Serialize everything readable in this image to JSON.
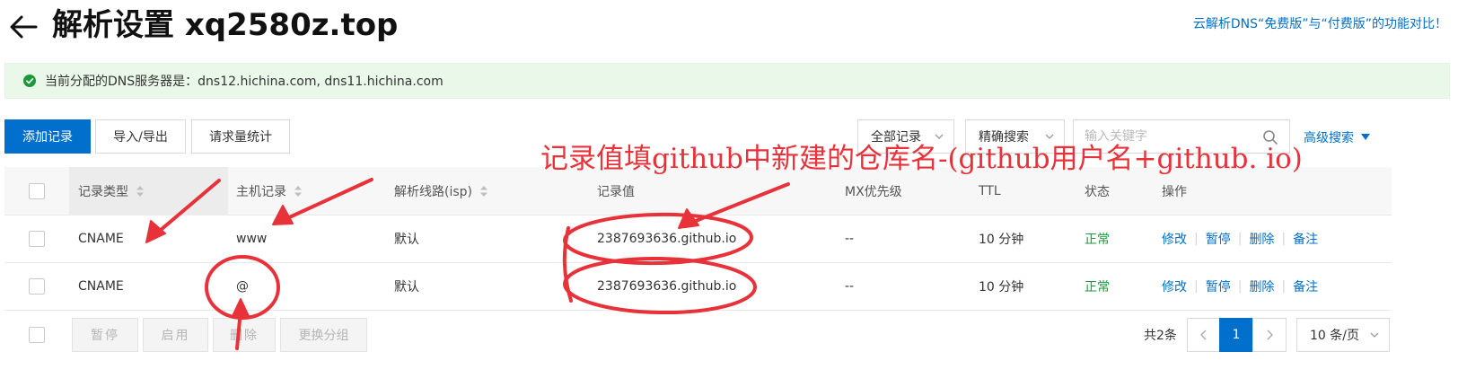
{
  "header": {
    "title": "解析设置 xq2580z.top",
    "compare_link": "云解析DNS“免费版”与“付费版”的功能对比！"
  },
  "notice": {
    "text": "当前分配的DNS服务器是：dns12.hichina.com, dns11.hichina.com"
  },
  "toolbar": {
    "add_record": "添加记录",
    "import_export": "导入/导出",
    "request_stats": "请求量统计",
    "filter_select": "全部记录",
    "search_mode": "精确搜索",
    "search_placeholder": "输入关键字",
    "advanced_search": "高级搜索"
  },
  "table": {
    "headers": {
      "type": "记录类型",
      "host": "主机记录",
      "line": "解析线路(isp)",
      "value": "记录值",
      "mx": "MX优先级",
      "ttl": "TTL",
      "status": "状态",
      "actions": "操作"
    },
    "rows": [
      {
        "type": "CNAME",
        "host": "www",
        "line": "默认",
        "value": "2387693636.github.io",
        "mx": "--",
        "ttl": "10 分钟",
        "status": "正常",
        "actions": [
          "修改",
          "暂停",
          "删除",
          "备注"
        ]
      },
      {
        "type": "CNAME",
        "host": "@",
        "line": "默认",
        "value": "2387693636.github.io",
        "mx": "--",
        "ttl": "10 分钟",
        "status": "正常",
        "actions": [
          "修改",
          "暂停",
          "删除",
          "备注"
        ]
      }
    ]
  },
  "bulk_actions": {
    "pause": "暂停",
    "enable": "启用",
    "delete": "删除",
    "change_group": "更换分组"
  },
  "pagination": {
    "total": "共2条",
    "current_page": "1",
    "page_size": "10 条/页"
  },
  "annotation": {
    "text": "记录值填github中新建的仓库名-(github用户名+github. io)"
  },
  "colors": {
    "primary": "#0070cc",
    "success": "#1a9a3a",
    "annotation": "#e8323a",
    "notice_bg": "#eaf8ea"
  }
}
